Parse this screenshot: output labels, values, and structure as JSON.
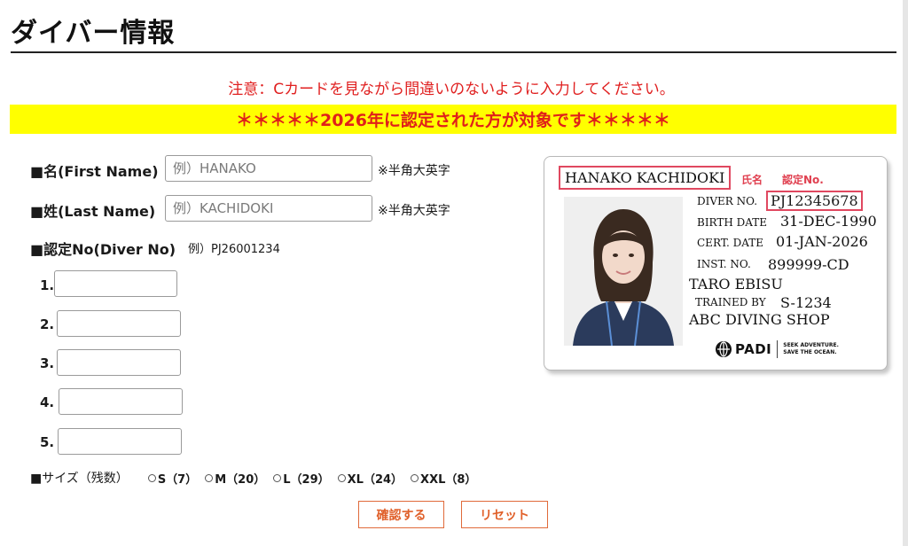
{
  "page": {
    "title": "ダイバー情報"
  },
  "notice": "注意：Cカードを見ながら間違いのないように入力してください。",
  "banner": "＊＊＊＊＊2026年に認定された方が対象です＊＊＊＊＊",
  "form": {
    "first_name": {
      "label": "■名(First Name)",
      "placeholder": "例）HANAKO",
      "note": "※半角大英字"
    },
    "last_name": {
      "label": "■姓(Last Name)",
      "placeholder": "例）KACHIDOKI",
      "note": "※半角大英字"
    },
    "diver_no": {
      "label": "■認定No(Diver No)",
      "example": "例）PJ26001234",
      "items": [
        "1.",
        "2.",
        "3.",
        "4.",
        "5."
      ]
    },
    "sizes": {
      "label": "■サイズ（残数）",
      "options": [
        {
          "label": "S（7）"
        },
        {
          "label": "M（20）"
        },
        {
          "label": "L（29）"
        },
        {
          "label": "XL（24）"
        },
        {
          "label": "XXL（8）"
        }
      ]
    },
    "confirm_button": "確認する",
    "reset_button": "リセット"
  },
  "card": {
    "name": "HANAKO KACHIDOKI",
    "name_tag": "氏名",
    "cert_tag": "認定No.",
    "diver_no_label": "DIVER NO.",
    "diver_no": "PJ12345678",
    "birth_label": "BIRTH DATE",
    "birth": "31-DEC-1990",
    "cert_label": "CERT. DATE",
    "cert": "01-JAN-2026",
    "inst_label": "INST. NO.",
    "inst": "899999-CD",
    "instructor": "TARO EBISU",
    "trained_label": "TRAINED BY",
    "trained": "S-1234",
    "shop": "ABC DIVING SHOP",
    "logo": "PADI",
    "tagline_1": "SEEK ADVENTURE.",
    "tagline_2": "SAVE THE OCEAN."
  }
}
